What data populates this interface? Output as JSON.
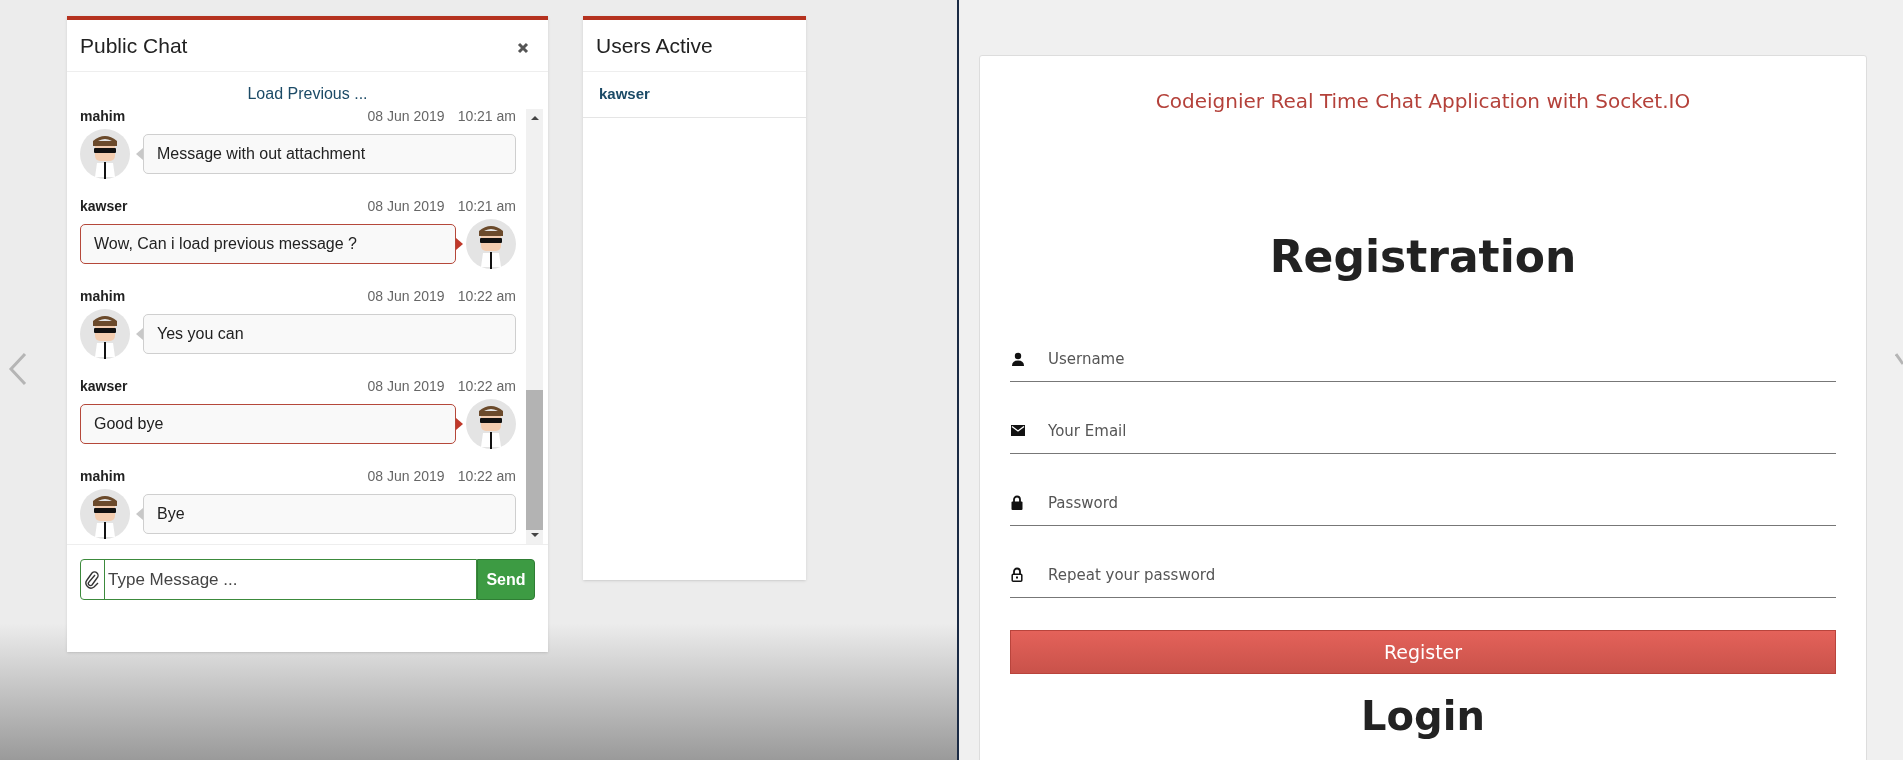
{
  "chat": {
    "title": "Public Chat",
    "load_previous": "Load Previous ...",
    "messages": [
      {
        "sender": "mahim",
        "date": "08 Jun 2019",
        "time": "10:21 am",
        "text": "Message with out attachment",
        "kind": "incoming"
      },
      {
        "sender": "kawser",
        "date": "08 Jun 2019",
        "time": "10:21 am",
        "text": "Wow, Can i load previous message ?",
        "kind": "outgoing"
      },
      {
        "sender": "mahim",
        "date": "08 Jun 2019",
        "time": "10:22 am",
        "text": "Yes you can",
        "kind": "incoming"
      },
      {
        "sender": "kawser",
        "date": "08 Jun 2019",
        "time": "10:22 am",
        "text": "Good bye",
        "kind": "outgoing"
      },
      {
        "sender": "mahim",
        "date": "08 Jun 2019",
        "time": "10:22 am",
        "text": "Bye",
        "kind": "incoming"
      }
    ],
    "input": {
      "placeholder": "Type Message ..."
    },
    "send": "Send"
  },
  "users": {
    "title": "Users Active",
    "items": [
      {
        "name": "kawser"
      }
    ]
  },
  "app": {
    "title": "Codeignier Real Time Chat Application with Socket.IO",
    "registration": {
      "heading": "Registration",
      "fields": [
        {
          "kind": "user",
          "placeholder": "Username"
        },
        {
          "kind": "email",
          "placeholder": "Your Email"
        },
        {
          "kind": "password",
          "placeholder": "Password"
        },
        {
          "kind": "repeat",
          "placeholder": "Repeat your password"
        }
      ],
      "button": "Register"
    },
    "login": {
      "heading": "Login"
    }
  }
}
